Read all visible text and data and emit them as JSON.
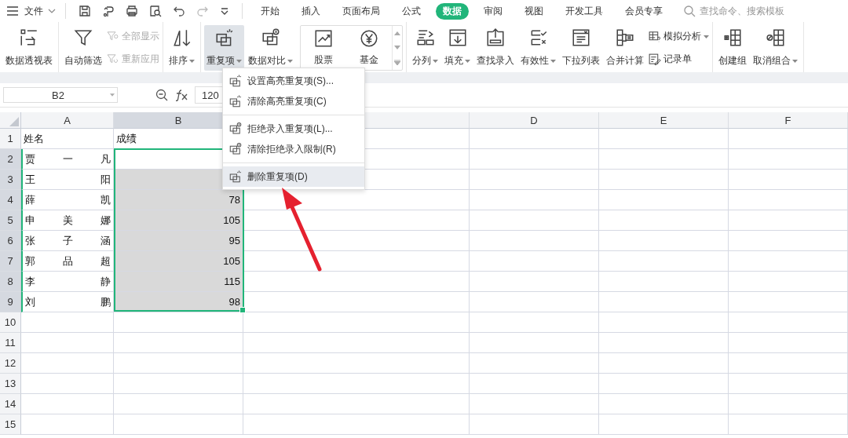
{
  "menu_bar": {
    "app_menu": "文件",
    "tabs": [
      {
        "label": "开始",
        "selected": false
      },
      {
        "label": "插入",
        "selected": false
      },
      {
        "label": "页面布局",
        "selected": false
      },
      {
        "label": "公式",
        "selected": false
      },
      {
        "label": "数据",
        "selected": true
      },
      {
        "label": "审阅",
        "selected": false
      },
      {
        "label": "视图",
        "selected": false
      },
      {
        "label": "开发工具",
        "selected": false
      },
      {
        "label": "会员专享",
        "selected": false
      }
    ],
    "search": {
      "placeholder": "查找命令、搜索模板"
    }
  },
  "ribbon": {
    "groups": [
      [
        {
          "kind": "large",
          "label": "数据透视表",
          "dropdown": false,
          "pressed": false
        }
      ],
      [
        {
          "kind": "large",
          "label": "自动筛选",
          "dropdown": false,
          "pressed": false
        },
        {
          "kind": "stack",
          "items": [
            {
              "label": "全部显示",
              "disabled": true,
              "dropdown": false
            },
            {
              "label": "重新应用",
              "disabled": true,
              "dropdown": false
            }
          ]
        }
      ],
      [
        {
          "kind": "large",
          "label": "排序",
          "dropdown": true,
          "pressed": false
        }
      ],
      [
        {
          "kind": "large",
          "label": "重复项",
          "dropdown": true,
          "pressed": true
        },
        {
          "kind": "large",
          "label": "数据对比",
          "dropdown": true,
          "pressed": false
        },
        {
          "kind": "gallery",
          "items": [
            {
              "label": "股票"
            },
            {
              "label": "基金"
            }
          ]
        }
      ],
      [
        {
          "kind": "large",
          "label": "分列",
          "dropdown": true,
          "pressed": false
        },
        {
          "kind": "large",
          "label": "填充",
          "dropdown": true,
          "pressed": false
        },
        {
          "kind": "large",
          "label": "查找录入",
          "dropdown": false,
          "pressed": false
        },
        {
          "kind": "large",
          "label": "有效性",
          "dropdown": true,
          "pressed": false
        },
        {
          "kind": "large",
          "label": "下拉列表",
          "dropdown": false,
          "pressed": false
        },
        {
          "kind": "large",
          "label": "合并计算",
          "dropdown": false,
          "pressed": false
        },
        {
          "kind": "stack",
          "items": [
            {
              "label": "模拟分析",
              "disabled": false,
              "dropdown": true
            },
            {
              "label": "记录单",
              "disabled": false,
              "dropdown": false
            }
          ]
        }
      ],
      [
        {
          "kind": "large",
          "label": "创建组",
          "dropdown": false,
          "pressed": false
        },
        {
          "kind": "large",
          "label": "取消组合",
          "dropdown": true,
          "pressed": false
        }
      ]
    ]
  },
  "formula_bar": {
    "name_box": "B2",
    "value": "120"
  },
  "sheet": {
    "columns": [
      {
        "label": "A",
        "selected": false
      },
      {
        "label": "B",
        "selected": true
      },
      {
        "selected": false
      },
      {
        "label": "D",
        "selected": false
      },
      {
        "label": "E",
        "selected": false
      },
      {
        "label": "F",
        "selected": false
      }
    ],
    "rows": [
      {
        "label": "1",
        "kind": "header",
        "selected": false,
        "cells": [
          {
            "text": "姓名",
            "selected": false
          },
          {
            "text": "成绩",
            "selected": false
          }
        ]
      },
      {
        "label": "2",
        "kind": "data",
        "selected": true,
        "cells": [
          {
            "text": "贾一凡",
            "selected": false
          },
          {
            "selected": false
          }
        ]
      },
      {
        "label": "3",
        "kind": "data",
        "selected": true,
        "cells": [
          {
            "text": "王阳",
            "selected": false
          },
          {
            "selected": true
          }
        ]
      },
      {
        "label": "4",
        "kind": "data",
        "selected": true,
        "cells": [
          {
            "text": "薛凯",
            "selected": false
          },
          {
            "text": "78",
            "selected": true
          }
        ]
      },
      {
        "label": "5",
        "kind": "data",
        "selected": true,
        "cells": [
          {
            "text": "申美娜",
            "selected": false
          },
          {
            "text": "105",
            "selected": true
          }
        ]
      },
      {
        "label": "6",
        "kind": "data",
        "selected": true,
        "cells": [
          {
            "text": "张子涵",
            "selected": false
          },
          {
            "text": "95",
            "selected": true
          }
        ]
      },
      {
        "label": "7",
        "kind": "data",
        "selected": true,
        "cells": [
          {
            "text": "郭品超",
            "selected": false
          },
          {
            "text": "105",
            "selected": true
          }
        ]
      },
      {
        "label": "8",
        "kind": "data",
        "selected": true,
        "cells": [
          {
            "text": "李静",
            "selected": false
          },
          {
            "text": "115",
            "selected": true
          }
        ]
      },
      {
        "label": "9",
        "kind": "data",
        "selected": true,
        "cells": [
          {
            "text": "刘鹏",
            "selected": false
          },
          {
            "text": "98",
            "selected": true
          }
        ]
      },
      {
        "label": "10",
        "selected": false
      },
      {
        "label": "11",
        "selected": false
      },
      {
        "label": "12",
        "selected": false
      },
      {
        "label": "13",
        "selected": false
      },
      {
        "label": "14",
        "selected": false
      },
      {
        "label": "15",
        "selected": false
      }
    ]
  },
  "dropdown_menu": {
    "items": [
      {
        "kind": "item",
        "label": "设置高亮重复项(S)...",
        "selected": false
      },
      {
        "kind": "item",
        "label": "清除高亮重复项(C)",
        "selected": false
      },
      {
        "kind": "separator"
      },
      {
        "kind": "item",
        "label": "拒绝录入重复项(L)...",
        "selected": false
      },
      {
        "kind": "item",
        "label": "清除拒绝录入限制(R)",
        "selected": false
      },
      {
        "kind": "separator"
      },
      {
        "kind": "item",
        "label": "删除重复项(D)",
        "selected": true
      }
    ]
  }
}
